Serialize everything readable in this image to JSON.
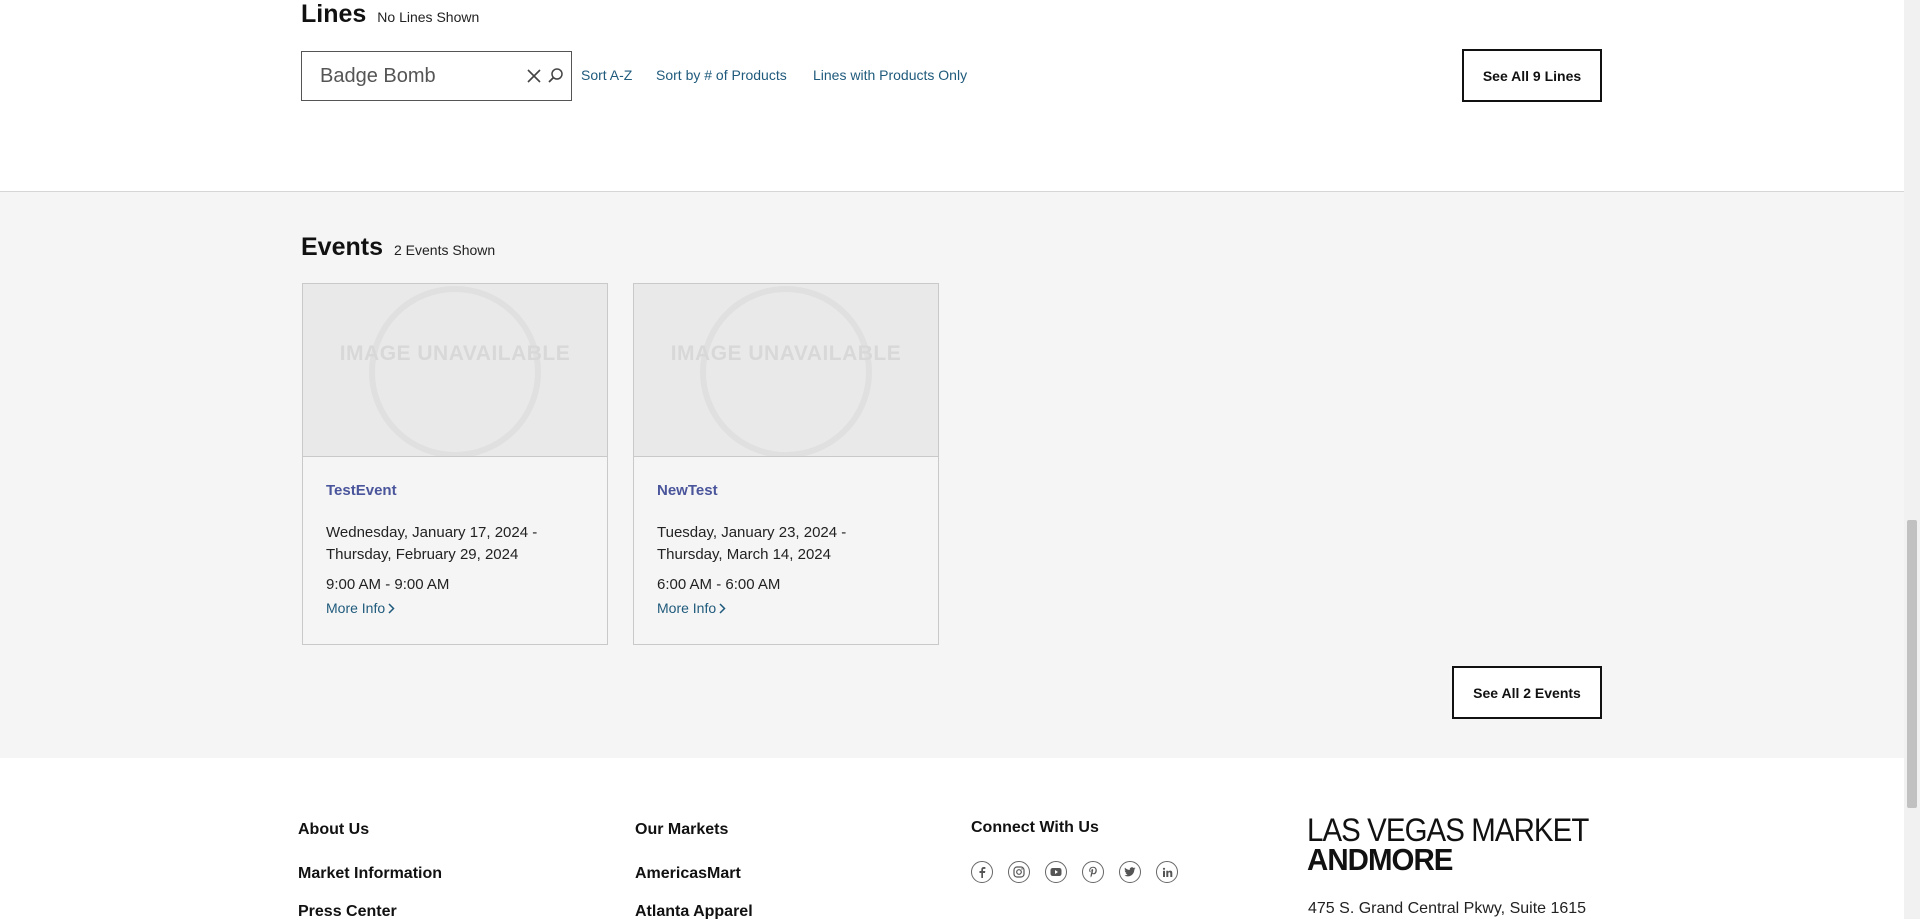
{
  "lines": {
    "title": "Lines",
    "count_text": "No Lines Shown",
    "search_value": "Badge Bomb",
    "sort_options": [
      "Sort A-Z",
      "Sort by # of Products",
      "Lines with Products Only"
    ],
    "see_all_label": "See All 9 Lines"
  },
  "events": {
    "title": "Events",
    "count_text": "2 Events Shown",
    "image_placeholder": "IMAGE UNAVAILABLE",
    "items": [
      {
        "name": "TestEvent",
        "date_line1": "Wednesday, January 17, 2024 -",
        "date_line2": "Thursday, February 29, 2024",
        "time": "9:00 AM - 9:00 AM",
        "more_info": "More Info"
      },
      {
        "name": "NewTest",
        "date_line1": "Tuesday, January 23, 2024 -",
        "date_line2": "Thursday, March 14, 2024",
        "time": "6:00 AM - 6:00 AM",
        "more_info": "More Info"
      }
    ],
    "see_all_label": "See All 2 Events"
  },
  "footer": {
    "col1": {
      "heading": "About Us",
      "links": [
        "Market Information",
        "Press Center"
      ]
    },
    "col2": {
      "heading": "Our Markets",
      "links": [
        "AmericasMart",
        "Atlanta Apparel"
      ]
    },
    "col3": {
      "heading": "Connect With Us"
    },
    "social_icons": [
      "facebook-icon",
      "instagram-icon",
      "youtube-icon",
      "pinterest-icon",
      "twitter-icon",
      "linkedin-icon"
    ],
    "logo_line1": "LAS VEGAS MARKET",
    "logo_line2": "ANDMORE",
    "address": "475 S. Grand Central Pkwy, Suite 1615"
  }
}
